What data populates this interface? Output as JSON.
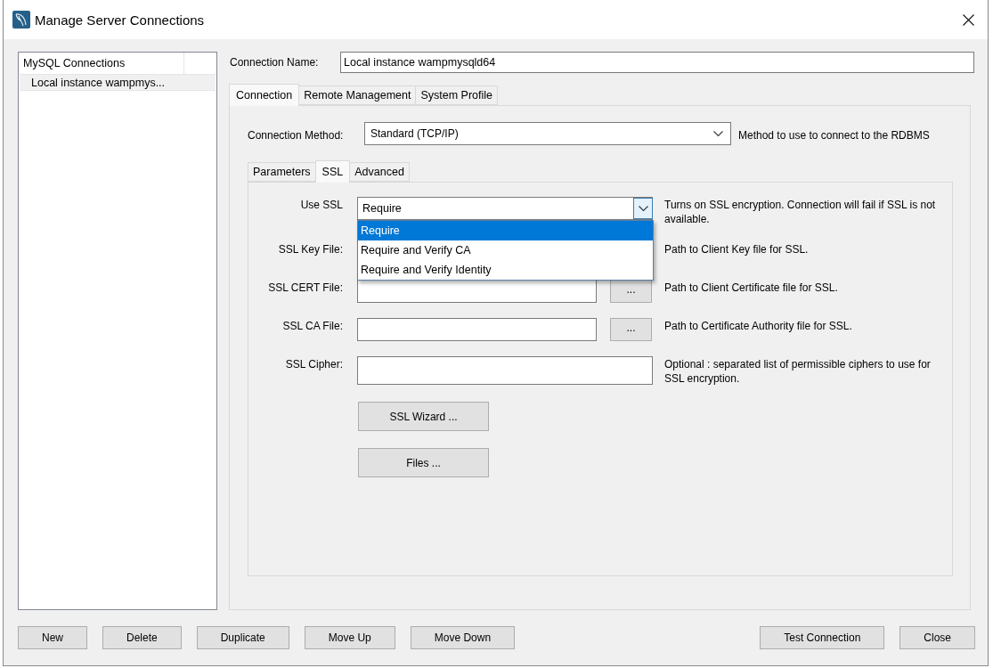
{
  "window": {
    "title": "Manage Server Connections"
  },
  "connections_list": {
    "header": "MySQL Connections",
    "items": [
      {
        "label": "Local instance wampmys...",
        "selected": true
      }
    ]
  },
  "connection_name": {
    "label": "Connection Name:",
    "value": "Local instance wampmysqld64"
  },
  "tabs": [
    {
      "label": "Connection",
      "selected": true
    },
    {
      "label": "Remote Management",
      "selected": false
    },
    {
      "label": "System Profile",
      "selected": false
    }
  ],
  "connection_method": {
    "label": "Connection Method:",
    "value": "Standard (TCP/IP)",
    "description": "Method to use to connect to the RDBMS"
  },
  "sub_tabs": [
    {
      "label": "Parameters",
      "selected": false
    },
    {
      "label": "SSL",
      "selected": true
    },
    {
      "label": "Advanced",
      "selected": false
    }
  ],
  "ssl_fields": [
    {
      "kind": "select",
      "label": "Use SSL",
      "value": "Require",
      "expanded": true,
      "options": [
        {
          "label": "Require",
          "selected": true
        },
        {
          "label": "Require and Verify CA",
          "selected": false
        },
        {
          "label": "Require and Verify Identity",
          "selected": false
        }
      ],
      "description": "Turns on SSL encryption. Connection will fail if SSL is not available."
    },
    {
      "kind": "covered",
      "label": "SSL Key File:",
      "description": "Path to Client Key file for SSL."
    },
    {
      "kind": "file",
      "label": "SSL CERT File:",
      "browse": "...",
      "description": "Path to Client Certificate file for SSL."
    },
    {
      "kind": "file",
      "label": "SSL CA File:",
      "browse": "...",
      "description": "Path to Certificate Authority file for SSL."
    },
    {
      "kind": "text",
      "label": "SSL Cipher:",
      "description": "Optional : separated list of permissible ciphers to use for SSL encryption."
    }
  ],
  "ssl_buttons": [
    "SSL Wizard ...",
    "Files ..."
  ],
  "left_buttons": [
    "New",
    "Delete",
    "Duplicate",
    "Move Up",
    "Move Down"
  ],
  "right_buttons": [
    "Test Connection",
    "Close"
  ]
}
